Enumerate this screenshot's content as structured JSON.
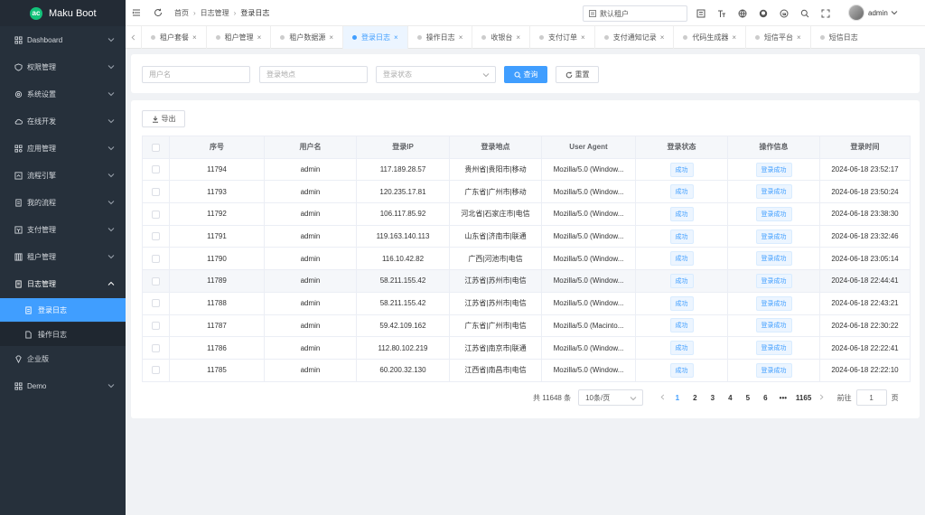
{
  "app": {
    "title": "Maku Boot",
    "logo_text": "ac"
  },
  "sidebar": {
    "items": [
      {
        "label": "Dashboard",
        "icon": "grid-icon"
      },
      {
        "label": "权限管理",
        "icon": "shield-icon"
      },
      {
        "label": "系统设置",
        "icon": "gear-icon"
      },
      {
        "label": "在线开发",
        "icon": "cloud-icon"
      },
      {
        "label": "应用管理",
        "icon": "apps-icon"
      },
      {
        "label": "流程引擎",
        "icon": "flow-icon"
      },
      {
        "label": "我的流程",
        "icon": "document-icon"
      },
      {
        "label": "支付管理",
        "icon": "payment-icon"
      },
      {
        "label": "租户管理",
        "icon": "tenant-icon"
      },
      {
        "label": "日志管理",
        "icon": "log-icon"
      }
    ],
    "log_children": [
      {
        "label": "登录日志",
        "icon": "login-log-icon"
      },
      {
        "label": "操作日志",
        "icon": "operation-log-icon"
      }
    ],
    "tail_items": [
      {
        "label": "企业版",
        "icon": "diamond-icon"
      },
      {
        "label": "Demo",
        "icon": "demo-icon"
      }
    ]
  },
  "header": {
    "breadcrumb": [
      "首页",
      "日志管理",
      "登录日志"
    ],
    "tenant_selector": "默认租户",
    "username": "admin"
  },
  "tabs": [
    {
      "label": "租户套餐"
    },
    {
      "label": "租户管理"
    },
    {
      "label": "租户数据源"
    },
    {
      "label": "登录日志",
      "active": true
    },
    {
      "label": "操作日志"
    },
    {
      "label": "收银台"
    },
    {
      "label": "支付订单"
    },
    {
      "label": "支付通知记录"
    },
    {
      "label": "代码生成器"
    },
    {
      "label": "短信平台"
    },
    {
      "label": "短信日志"
    }
  ],
  "search": {
    "username_placeholder": "用户名",
    "address_placeholder": "登录地点",
    "status_placeholder": "登录状态",
    "query_label": "查询",
    "reset_label": "重置"
  },
  "toolbar": {
    "export_label": "导出"
  },
  "table": {
    "columns": [
      "序号",
      "用户名",
      "登录IP",
      "登录地点",
      "User Agent",
      "登录状态",
      "操作信息",
      "登录时间"
    ],
    "rows": [
      {
        "id": "11794",
        "user": "admin",
        "ip": "117.189.28.57",
        "addr": "贵州省|贵阳市|移动",
        "ua": "Mozilla/5.0 (Window...",
        "status": "成功",
        "info": "登录成功",
        "time": "2024-06-18 23:52:17"
      },
      {
        "id": "11793",
        "user": "admin",
        "ip": "120.235.17.81",
        "addr": "广东省|广州市|移动",
        "ua": "Mozilla/5.0 (Window...",
        "status": "成功",
        "info": "登录成功",
        "time": "2024-06-18 23:50:24"
      },
      {
        "id": "11792",
        "user": "admin",
        "ip": "106.117.85.92",
        "addr": "河北省|石家庄市|电信",
        "ua": "Mozilla/5.0 (Window...",
        "status": "成功",
        "info": "登录成功",
        "time": "2024-06-18 23:38:30"
      },
      {
        "id": "11791",
        "user": "admin",
        "ip": "119.163.140.113",
        "addr": "山东省|济南市|联通",
        "ua": "Mozilla/5.0 (Window...",
        "status": "成功",
        "info": "登录成功",
        "time": "2024-06-18 23:32:46"
      },
      {
        "id": "11790",
        "user": "admin",
        "ip": "116.10.42.82",
        "addr": "广西|河池市|电信",
        "ua": "Mozilla/5.0 (Window...",
        "status": "成功",
        "info": "登录成功",
        "time": "2024-06-18 23:05:14"
      },
      {
        "id": "11789",
        "user": "admin",
        "ip": "58.211.155.42",
        "addr": "江苏省|苏州市|电信",
        "ua": "Mozilla/5.0 (Window...",
        "status": "成功",
        "info": "登录成功",
        "time": "2024-06-18 22:44:41"
      },
      {
        "id": "11788",
        "user": "admin",
        "ip": "58.211.155.42",
        "addr": "江苏省|苏州市|电信",
        "ua": "Mozilla/5.0 (Window...",
        "status": "成功",
        "info": "登录成功",
        "time": "2024-06-18 22:43:21"
      },
      {
        "id": "11787",
        "user": "admin",
        "ip": "59.42.109.162",
        "addr": "广东省|广州市|电信",
        "ua": "Mozilla/5.0 (Macinto...",
        "status": "成功",
        "info": "登录成功",
        "time": "2024-06-18 22:30:22"
      },
      {
        "id": "11786",
        "user": "admin",
        "ip": "112.80.102.219",
        "addr": "江苏省|南京市|联通",
        "ua": "Mozilla/5.0 (Window...",
        "status": "成功",
        "info": "登录成功",
        "time": "2024-06-18 22:22:41"
      },
      {
        "id": "11785",
        "user": "admin",
        "ip": "60.200.32.130",
        "addr": "江西省|南昌市|电信",
        "ua": "Mozilla/5.0 (Window...",
        "status": "成功",
        "info": "登录成功",
        "time": "2024-06-18 22:22:10"
      }
    ]
  },
  "pagination": {
    "total_text": "共 11648 条",
    "page_size": "10条/页",
    "pages": [
      "1",
      "2",
      "3",
      "4",
      "5",
      "6"
    ],
    "ellipsis": "•••",
    "last_page": "1165",
    "goto_label": "前往",
    "goto_value": "1",
    "page_unit": "页"
  },
  "colors": {
    "sidebar_bg": "#26303b",
    "accent": "#409eff",
    "logo": "#13c27a"
  }
}
